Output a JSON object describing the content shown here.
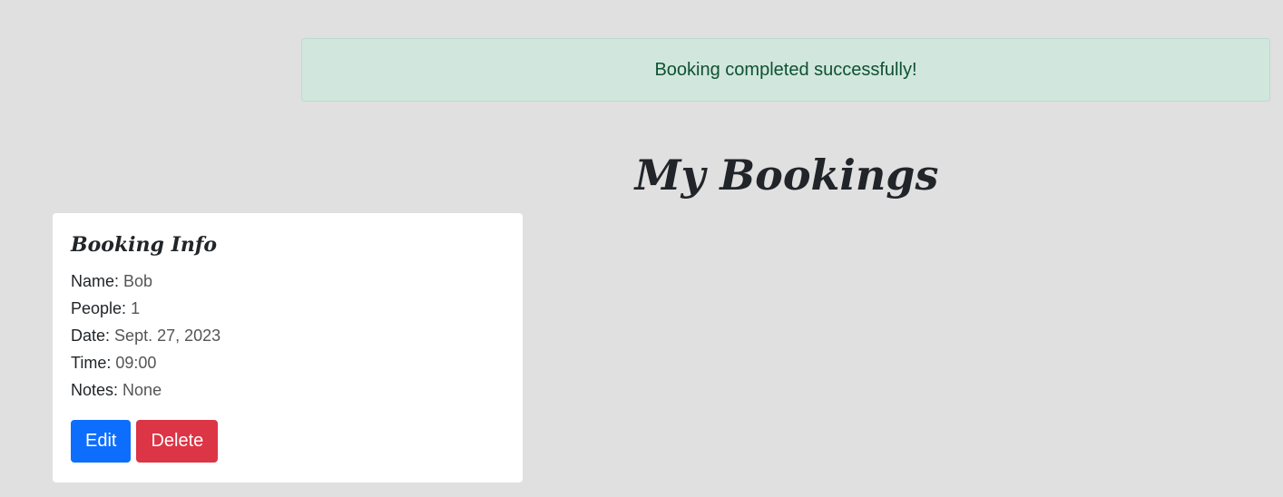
{
  "alert": {
    "message": "Booking completed successfully!",
    "background": "#d1e7dd",
    "text_color": "#0f5132"
  },
  "page": {
    "title": "My Bookings"
  },
  "booking_card": {
    "title": "Booking Info",
    "fields": [
      {
        "label": "Name:",
        "value": "Bob"
      },
      {
        "label": "People:",
        "value": "1"
      },
      {
        "label": "Date:",
        "value": "Sept. 27, 2023"
      },
      {
        "label": "Time:",
        "value": "09:00"
      },
      {
        "label": "Notes:",
        "value": "None"
      }
    ],
    "edit_label": "Edit",
    "delete_label": "Delete",
    "edit_color": "#0d6efd",
    "delete_color": "#dc3545"
  }
}
